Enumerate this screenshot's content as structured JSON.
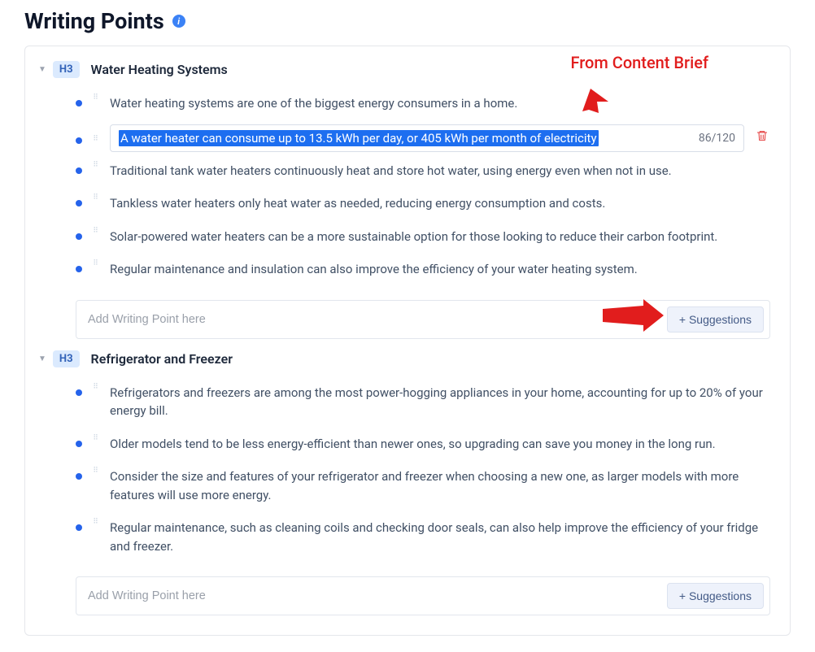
{
  "page_title": "Writing Points",
  "annotation": "From Content Brief",
  "add_placeholder": "Add Writing Point here",
  "suggestions_label": "+ Suggestions",
  "h3_label": "H3",
  "sections": [
    {
      "title": "Water Heating Systems",
      "selected": {
        "text": "A water heater can consume up to 13.5 kWh per day, or 405 kWh per month of electricity",
        "count": "86/120"
      },
      "points": [
        "Water heating systems are one of the biggest energy consumers in a home.",
        "__SELECTED__",
        "Traditional tank water heaters continuously heat and store hot water, using energy even when not in use.",
        "Tankless water heaters only heat water as needed, reducing energy consumption and costs.",
        "Solar-powered water heaters can be a more sustainable option for those looking to reduce their carbon footprint.",
        "Regular maintenance and insulation can also improve the efficiency of your water heating system."
      ]
    },
    {
      "title": "Refrigerator and Freezer",
      "points": [
        "Refrigerators and freezers are among the most power-hogging appliances in your home, accounting for up to 20% of your energy bill.",
        "Older models tend to be less energy-efficient than newer ones, so upgrading can save you money in the long run.",
        "Consider the size and features of your refrigerator and freezer when choosing a new one, as larger models with more features will use more energy.",
        "Regular maintenance, such as cleaning coils and checking door seals, can also help improve the efficiency of your fridge and freezer."
      ]
    }
  ]
}
